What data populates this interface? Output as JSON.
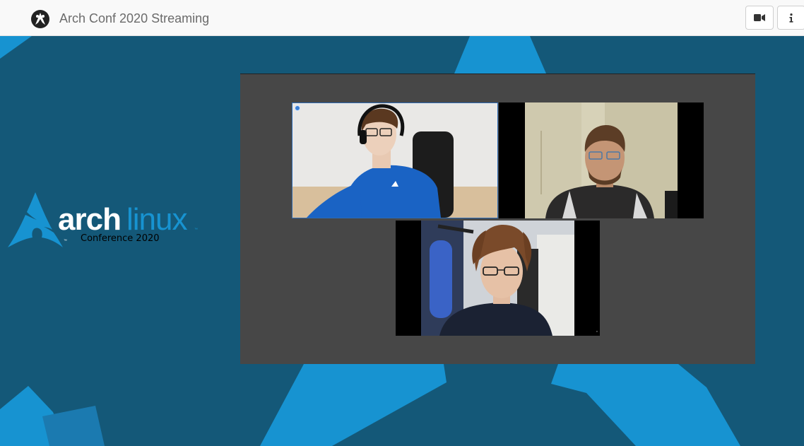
{
  "header": {
    "title": "Arch Conf 2020 Streaming",
    "logo_icon": "arch-conf-logo-icon",
    "buttons": [
      {
        "name": "camera-button",
        "icon": "video-camera-icon"
      },
      {
        "name": "info-button",
        "icon": "info-icon"
      }
    ]
  },
  "branding": {
    "arch": "arch",
    "linux": "linux",
    "subtitle": "Conference 2020",
    "trademark": "™"
  },
  "video_call": {
    "tiles": [
      {
        "name": "participant-1",
        "active": true
      },
      {
        "name": "participant-2",
        "active": false
      },
      {
        "name": "participant-3",
        "active": false
      }
    ]
  },
  "colors": {
    "background": "#145878",
    "accent": "#1793d1",
    "panel": "#474747",
    "header": "#f9f9f9"
  }
}
